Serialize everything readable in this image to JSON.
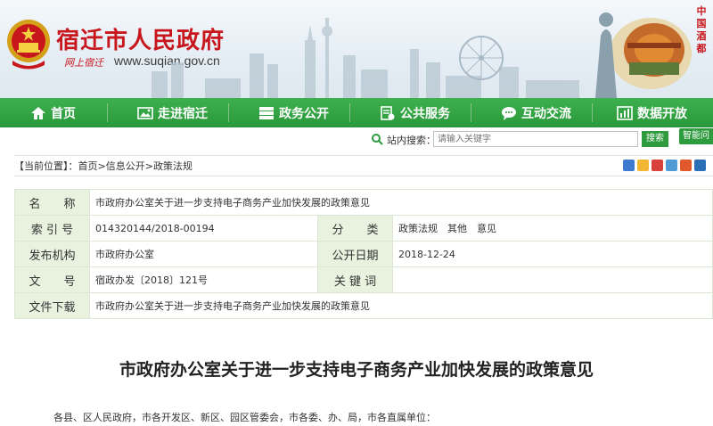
{
  "header": {
    "site_title": "宿迁市人民政府",
    "slogan": "网上宿迁",
    "url": "www.suqian.gov.cn",
    "stamp_text": "中国酒都"
  },
  "nav": {
    "items": [
      {
        "label": "首页",
        "icon": "home-icon"
      },
      {
        "label": "走进宿迁",
        "icon": "picture-icon"
      },
      {
        "label": "政务公开",
        "icon": "server-icon"
      },
      {
        "label": "公共服务",
        "icon": "clipboard-icon"
      },
      {
        "label": "互动交流",
        "icon": "chat-icon"
      },
      {
        "label": "数据开放",
        "icon": "chart-icon"
      }
    ]
  },
  "search": {
    "label": "站内搜索：",
    "placeholder": "请输入关键字",
    "button": "搜索",
    "smart_button": "智能问"
  },
  "breadcrumb": {
    "prefix": "【当前位置】：",
    "items": [
      "首页",
      "信息公开",
      "政策法规"
    ],
    "sep": ">"
  },
  "info": {
    "name_label": "名　　称",
    "name_value": "市政府办公室关于进一步支持电子商务产业加快发展的政策意见",
    "index_label": "索 引 号",
    "index_value": "014320144/2018-00194",
    "category_label": "分　　类",
    "category_value": "政策法规　其他　意见",
    "publisher_label": "发布机构",
    "publisher_value": "市政府办公室",
    "date_label": "公开日期",
    "date_value": "2018-12-24",
    "docno_label": "文　　号",
    "docno_value": "宿政办发〔2018〕121号",
    "keyword_label": "关 键 词",
    "keyword_value": "",
    "download_label": "文件下载",
    "download_value": "市政府办公室关于进一步支持电子商务产业加快发展的政策意见"
  },
  "article": {
    "title": "市政府办公室关于进一步支持电子商务产业加快发展的政策意见",
    "salutation": "各县、区人民政府，市各开发区、新区、园区管委会，市各委、办、局，市各直属单位："
  },
  "colors": {
    "brand_red": "#c8161d",
    "nav_green": "#2e9b3e",
    "table_label_bg": "#e8f2df"
  }
}
